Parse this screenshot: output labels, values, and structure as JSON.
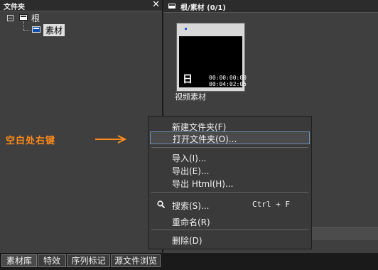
{
  "left_panel": {
    "title": "文件夹",
    "close_glyph": "✕",
    "tree": {
      "root_toggle": "−",
      "root_label": "根",
      "child_label": "素材"
    }
  },
  "right_panel": {
    "breadcrumb": "根/素材 (0/1)",
    "clip": {
      "icon_glyph": "日",
      "timecode_in": "00:00:00:00",
      "timecode_duration": "00:04:02:05",
      "name": "视频素材"
    }
  },
  "annotation": {
    "text": "空白处右键"
  },
  "context_menu": {
    "items": [
      {
        "label": "新建文件夹(F)"
      },
      {
        "label": "打开文件夹(O)..."
      },
      {
        "label": "导入(I)..."
      },
      {
        "label": "导出(E)..."
      },
      {
        "label": "导出 Html(H)..."
      },
      {
        "label": "搜索(S)...",
        "shortcut": "Ctrl + F"
      },
      {
        "label": "重命名(R)"
      },
      {
        "label": "删除(D)"
      }
    ]
  },
  "tabs": [
    {
      "label": "素材库"
    },
    {
      "label": "特效"
    },
    {
      "label": "序列标记"
    },
    {
      "label": "源文件浏览"
    }
  ],
  "colors": {
    "annotation": "#ff8a1a",
    "folder_selected": "#0e4fae",
    "menu_highlight_border": "#6a8fb8"
  }
}
